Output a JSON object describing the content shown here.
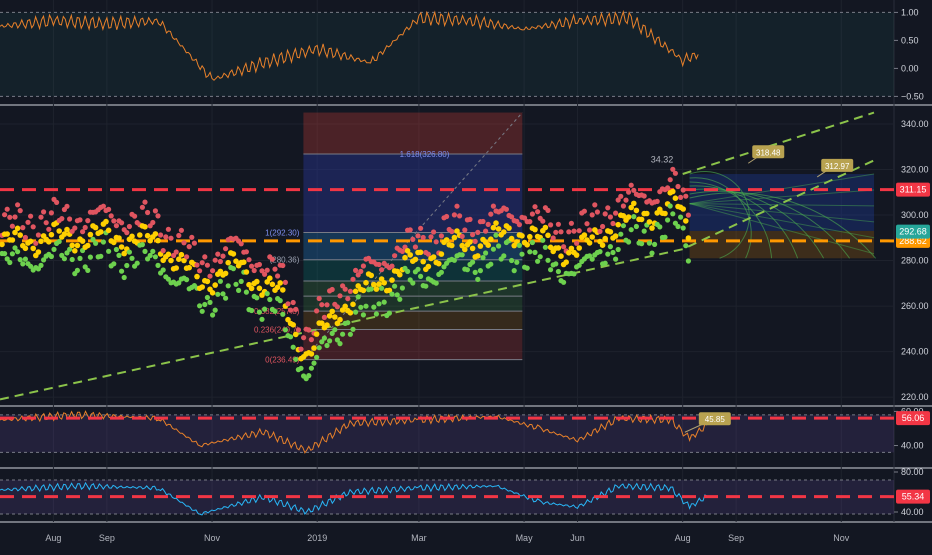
{
  "chart_data": [
    {
      "type": "line",
      "panel": "correlation",
      "ylim": [
        -0.6,
        1.15
      ],
      "y_ticks": [
        1.0,
        0.5,
        0.0,
        -0.5
      ],
      "y_tick_labels": [
        "1.00",
        "0.50",
        "0.00",
        "−0.50"
      ],
      "line_color": "#e8812a",
      "band": [
        -0.5,
        1.0
      ],
      "dates": [
        "2018-07-01",
        "2018-08-01",
        "2018-09-01",
        "2018-10-01",
        "2018-11-01",
        "2018-12-01",
        "2019-01-01",
        "2019-02-01",
        "2019-03-01",
        "2019-04-01",
        "2019-05-01",
        "2019-06-01",
        "2019-07-01",
        "2019-08-01",
        "2019-08-10"
      ],
      "values": [
        0.75,
        0.85,
        0.8,
        0.85,
        -0.2,
        0.1,
        0.35,
        0.1,
        0.9,
        0.85,
        0.7,
        0.85,
        0.9,
        0.15,
        0.25
      ]
    },
    {
      "type": "scatter",
      "panel": "price",
      "ylim": [
        217,
        347
      ],
      "y_ticks": [
        220,
        240,
        260,
        280,
        300,
        320,
        340
      ],
      "x_tick_labels": [
        "Aug",
        "Sep",
        "Nov",
        "2019",
        "Mar",
        "May",
        "Jun",
        "Aug",
        "Sep",
        "Nov"
      ],
      "x_tick_dates": [
        "2018-08-01",
        "2018-09-01",
        "2018-11-01",
        "2019-01-01",
        "2019-03-01",
        "2019-05-01",
        "2019-06-01",
        "2019-08-01",
        "2019-09-01",
        "2019-11-01"
      ],
      "series_colors": {
        "close": "#ffd000",
        "high": "#e05560",
        "low": "#6dd14e"
      },
      "close_path": [
        [
          "2018-07-01",
          287
        ],
        [
          "2018-08-01",
          290
        ],
        [
          "2018-09-01",
          291
        ],
        [
          "2018-10-01",
          288
        ],
        [
          "2018-10-25",
          270
        ],
        [
          "2018-11-15",
          278
        ],
        [
          "2018-12-10",
          265
        ],
        [
          "2018-12-26",
          238
        ],
        [
          "2019-01-15",
          260
        ],
        [
          "2019-02-15",
          275
        ],
        [
          "2019-03-15",
          285
        ],
        [
          "2019-04-15",
          290
        ],
        [
          "2019-05-01",
          293
        ],
        [
          "2019-05-20",
          285
        ],
        [
          "2019-06-05",
          285
        ],
        [
          "2019-06-20",
          295
        ],
        [
          "2019-07-10",
          300
        ],
        [
          "2019-07-28",
          305
        ],
        [
          "2019-08-05",
          292
        ]
      ],
      "horizontal_lines": [
        {
          "value": 311.15,
          "label": "311.15",
          "color": "#f23645",
          "style": "dashed"
        },
        {
          "value": 288.62,
          "label": "288.62",
          "color": "#ff9800",
          "style": "dashed"
        }
      ],
      "price_label": {
        "value": 292.68,
        "label": "292.68",
        "color": "#26a69a"
      },
      "fibonacci": {
        "start_date": "2018-12-24",
        "end_date": "2019-04-30",
        "low": 236.49,
        "high": 345,
        "levels": [
          {
            "ratio": "1.618",
            "price": 326.8,
            "label": "1.618(326.80)"
          },
          {
            "ratio": "1",
            "price": 292.3,
            "label": "1(292.30)"
          },
          {
            "ratio": "0.786",
            "price": 280.36,
            "label": "(280.36)"
          },
          {
            "ratio": "0.618",
            "price": 271.0,
            "label": ""
          },
          {
            "ratio": "0.5",
            "price": 264.4,
            "label": ""
          },
          {
            "ratio": "0.382",
            "price": 257.8,
            "label": "0.382(257.8)"
          },
          {
            "ratio": "0.236",
            "price": 249.7,
            "label": "0.236(249.7)"
          },
          {
            "ratio": "0",
            "price": 236.49,
            "label": "0(236.49)"
          }
        ]
      },
      "callouts": [
        {
          "text": "318.48",
          "date": "2019-09-15",
          "value": 328
        },
        {
          "text": "312.97",
          "date": "2019-10-25",
          "value": 322
        },
        {
          "text": "34.32",
          "date": "2019-07-20",
          "value": 323
        }
      ],
      "channel": {
        "lower": [
          [
            "2018-07-01",
            219
          ],
          [
            "2019-08-01",
            285
          ],
          [
            "2019-11-20",
            324
          ]
        ],
        "upper": [
          [
            "2019-08-01",
            318
          ],
          [
            "2019-11-20",
            345
          ]
        ],
        "color": "#8bc34a"
      }
    },
    {
      "type": "line",
      "panel": "rsi",
      "ylim": [
        28,
        62
      ],
      "y_ticks": [
        60,
        40
      ],
      "y_tick_labels": [
        "60.00",
        "40.00"
      ],
      "line_color": "#e8812a",
      "band": [
        36,
        58
      ],
      "reference": {
        "value": 56.06,
        "label": "56.06",
        "color": "#f23645"
      },
      "callout": {
        "text": "45.85",
        "date": "2019-08-15",
        "value": 56
      },
      "dates": [
        "2018-07-01",
        "2018-08-15",
        "2018-10-01",
        "2018-10-25",
        "2018-12-01",
        "2018-12-26",
        "2019-01-20",
        "2019-03-01",
        "2019-04-15",
        "2019-05-10",
        "2019-06-01",
        "2019-06-25",
        "2019-07-25",
        "2019-08-05",
        "2019-08-15"
      ],
      "values": [
        55,
        58,
        56,
        40,
        48,
        37,
        53,
        55,
        57,
        50,
        43,
        56,
        55,
        44,
        52
      ]
    },
    {
      "type": "line",
      "panel": "oscillator",
      "ylim": [
        32,
        82
      ],
      "y_ticks": [
        80,
        40
      ],
      "y_tick_labels": [
        "80.00",
        "40.00"
      ],
      "line_color": "#29b6f6",
      "band": [
        38,
        72
      ],
      "reference": {
        "value": 55.34,
        "label": "55.34",
        "color": "#f23645"
      },
      "dates": [
        "2018-07-01",
        "2018-08-15",
        "2018-10-01",
        "2018-10-25",
        "2018-12-01",
        "2018-12-26",
        "2019-01-20",
        "2019-03-01",
        "2019-04-15",
        "2019-05-10",
        "2019-06-01",
        "2019-06-25",
        "2019-07-25",
        "2019-08-05",
        "2019-08-15"
      ],
      "values": [
        62,
        66,
        64,
        38,
        55,
        40,
        60,
        64,
        66,
        50,
        45,
        66,
        64,
        45,
        56
      ]
    }
  ]
}
